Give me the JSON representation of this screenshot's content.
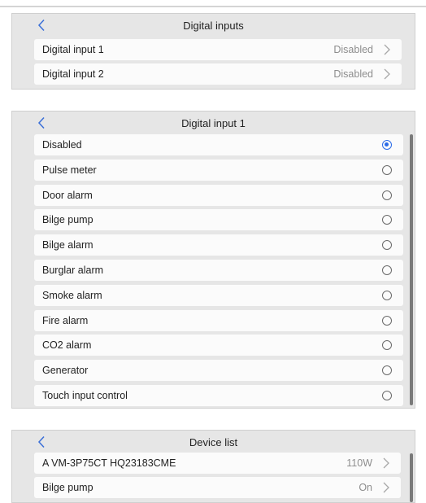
{
  "colors": {
    "accent": "#2b6be8",
    "panel_bg": "#e6e6e6",
    "row_bg": "#fbfbfb",
    "value_text": "#8d8d8d"
  },
  "digital_inputs": {
    "title": "Digital inputs",
    "items": [
      {
        "label": "Digital input 1",
        "value": "Disabled"
      },
      {
        "label": "Digital input 2",
        "value": "Disabled"
      }
    ]
  },
  "digital_input_1": {
    "title": "Digital input 1",
    "selected": "Disabled",
    "options": [
      {
        "label": "Disabled"
      },
      {
        "label": "Pulse meter"
      },
      {
        "label": "Door alarm"
      },
      {
        "label": "Bilge pump"
      },
      {
        "label": "Bilge alarm"
      },
      {
        "label": "Burglar alarm"
      },
      {
        "label": "Smoke alarm"
      },
      {
        "label": "Fire alarm"
      },
      {
        "label": "CO2 alarm"
      },
      {
        "label": "Generator"
      },
      {
        "label": "Touch input control"
      }
    ]
  },
  "device_list": {
    "title": "Device list",
    "items": [
      {
        "label": "A VM-3P75CT HQ23183CME",
        "value": "110W"
      },
      {
        "label": "Bilge pump",
        "value": "On"
      }
    ]
  },
  "icons": {
    "back": "chevron-left-icon",
    "forward": "chevron-right-icon",
    "radio_on": "radio-selected-icon",
    "radio_off": "radio-unselected-icon"
  }
}
